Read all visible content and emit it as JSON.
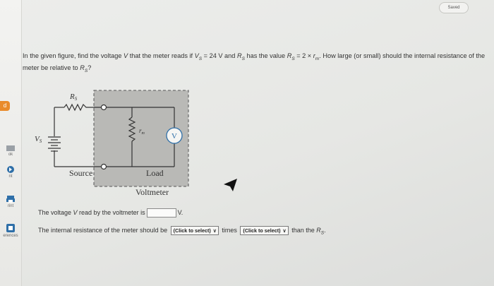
{
  "header": {
    "status": "Saved"
  },
  "sidebar": {
    "items": [
      {
        "label": "ok",
        "icon": "book-icon"
      },
      {
        "label": "nt",
        "icon": "print-icon"
      },
      {
        "label": "rint",
        "icon": "printer-icon"
      },
      {
        "label": "erences",
        "icon": "references-icon"
      }
    ],
    "chip": "d"
  },
  "question": {
    "p1": "In the given figure, find the voltage ",
    "v": "V",
    "p2": " that the meter reads if ",
    "vs": "V",
    "vs_sub": "S",
    "p3": " = 24 V and ",
    "rs": "R",
    "rs_sub": "S",
    "p4": " has the value ",
    "rs2": "R",
    "rs2_sub": "S",
    "p5": " = 2 × ",
    "rm": "r",
    "rm_sub": "m",
    "p6": ". How large (or small) should the internal resistance of the meter be relative to ",
    "rs3": "R",
    "rs3_sub": "S",
    "p7": "?"
  },
  "figure": {
    "label_rs": "R",
    "label_rs_sub": "S",
    "label_vs": "V",
    "label_vs_sub": "S",
    "label_rm": "r",
    "label_rm_sub": "m",
    "label_v": "V",
    "label_source": "Source",
    "label_load": "Load",
    "label_voltmeter": "Voltmeter"
  },
  "answers": {
    "line1_prefix": "The voltage ",
    "line1_v": "V",
    "line1_mid": " read by the voltmeter is",
    "line1_unit": "V.",
    "line2_prefix": "The internal resistance of the meter should be",
    "select1": "(Click to select)",
    "line2_mid": "times",
    "select2": "(Click to select)",
    "line2_suffix": "than the ",
    "line2_rs": "R",
    "line2_rs_sub": "S",
    "line2_end": "."
  },
  "colors": {
    "accent": "#e98b2b",
    "meter": "#2f6fa8",
    "shade": "#b9b9b6"
  }
}
